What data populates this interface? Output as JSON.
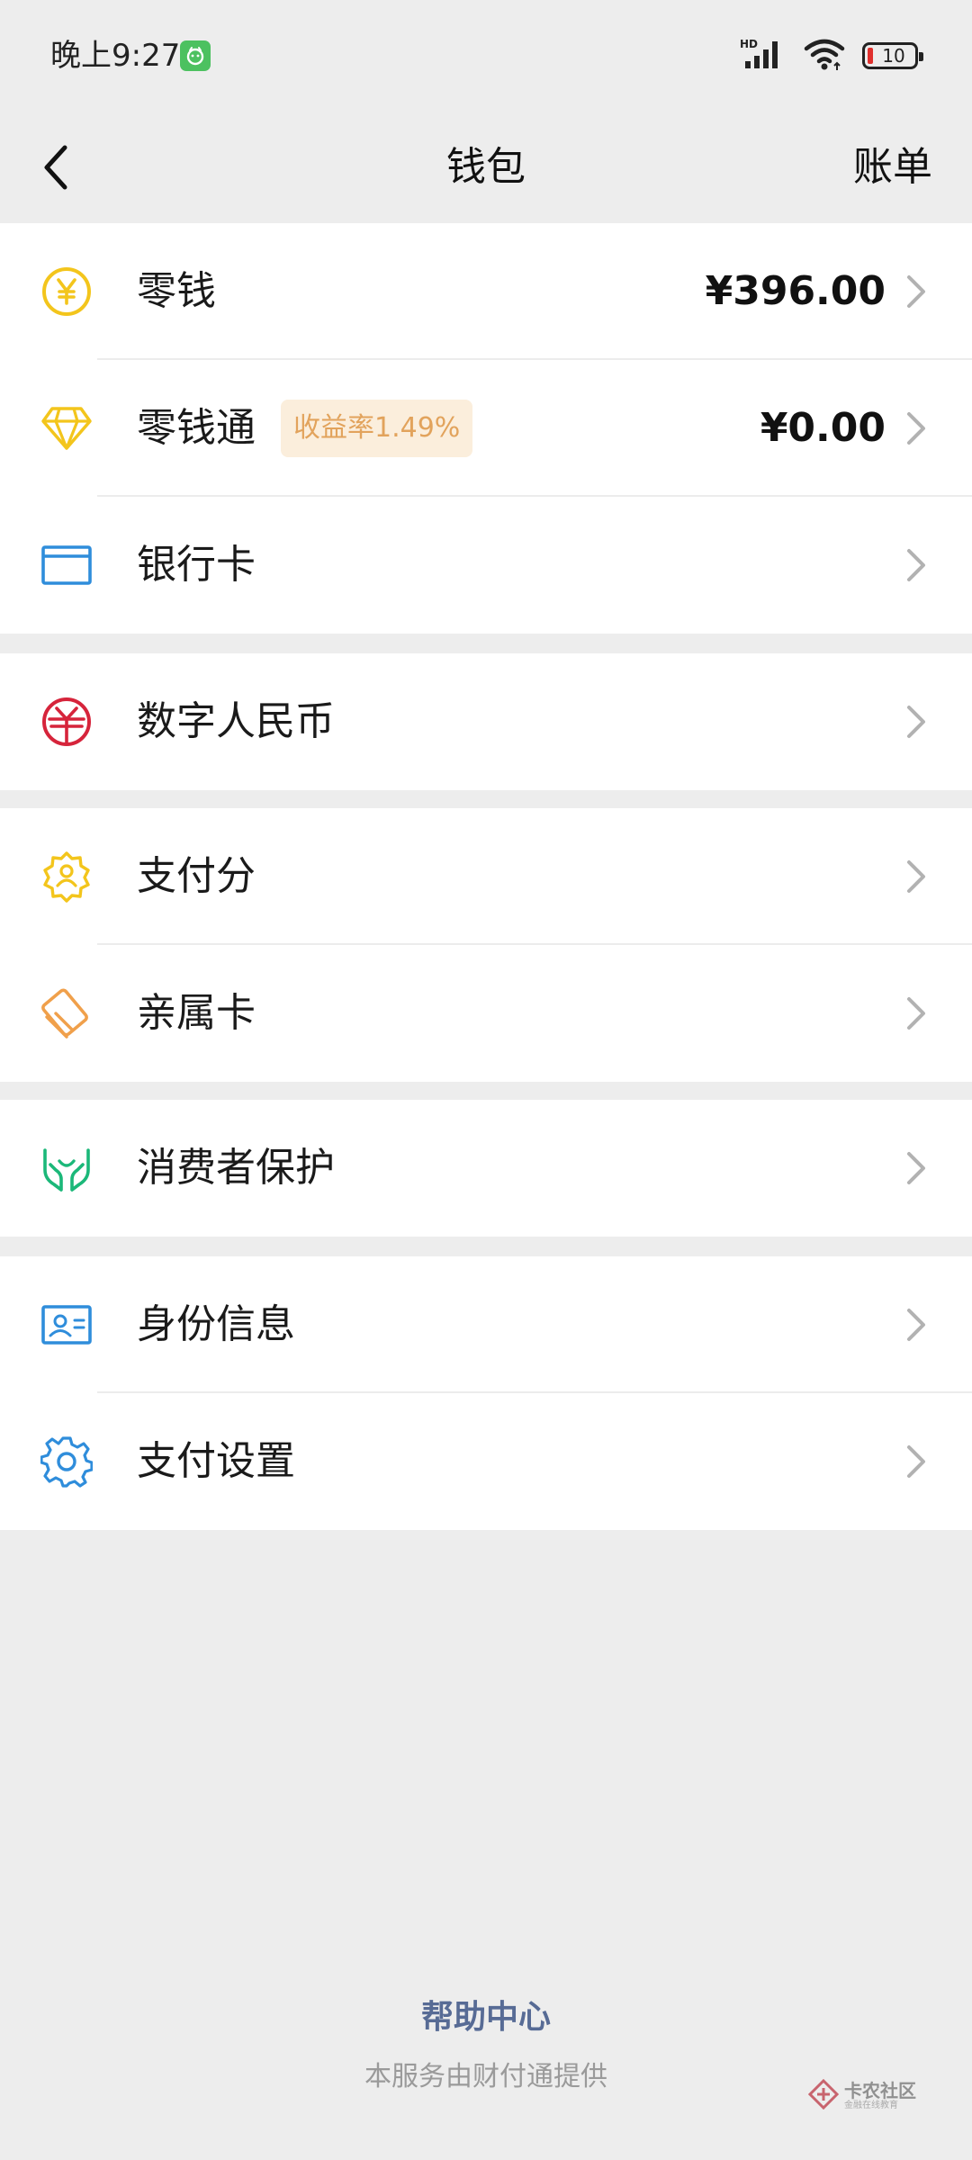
{
  "status_bar": {
    "time": "晚上9:27",
    "network": "HD",
    "battery_level": "10",
    "colors": {
      "app_badge": "#4cc160",
      "battery_low": "#e0302d"
    }
  },
  "nav": {
    "back_icon": "chevron-left-icon",
    "title": "钱包",
    "right_action": "账单"
  },
  "groups": [
    {
      "rows": [
        {
          "icon": "yuan-coin-icon",
          "label": "零钱",
          "value": "¥396.00"
        },
        {
          "icon": "diamond-icon",
          "label": "零钱通",
          "tag": "收益率1.49%",
          "value": "¥0.00"
        },
        {
          "icon": "bank-card-icon",
          "label": "银行卡"
        }
      ]
    },
    {
      "rows": [
        {
          "icon": "digital-rmb-icon",
          "label": "数字人民币"
        }
      ]
    },
    {
      "rows": [
        {
          "icon": "pay-score-badge-icon",
          "label": "支付分"
        },
        {
          "icon": "family-card-icon",
          "label": "亲属卡"
        }
      ]
    },
    {
      "rows": [
        {
          "icon": "protection-hands-icon",
          "label": "消费者保护"
        }
      ]
    },
    {
      "rows": [
        {
          "icon": "id-card-icon",
          "label": "身份信息"
        },
        {
          "icon": "gear-icon",
          "label": "支付设置"
        }
      ]
    }
  ],
  "footer": {
    "help_center": "帮助中心",
    "provider_note": "本服务由财付通提供",
    "link_color": "#576b95"
  },
  "watermark": {
    "title": "卡农社区",
    "subtitle": "金融在线教育"
  },
  "icon_colors": {
    "yellow": "#f3c51c",
    "blue": "#2f8ddb",
    "red": "#d6243b",
    "orange": "#f0a04b",
    "green": "#1bb879",
    "chevron": "#b2b2b2"
  }
}
